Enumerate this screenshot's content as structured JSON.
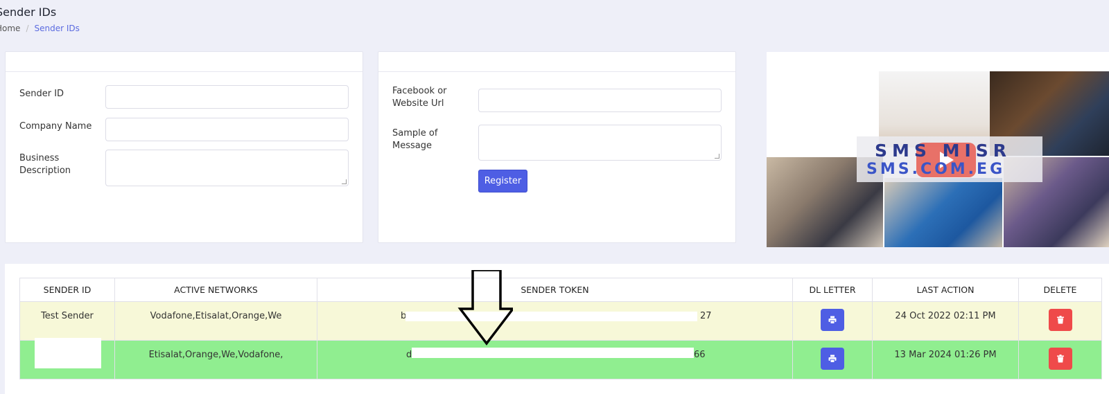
{
  "page": {
    "title": "Sender IDs",
    "breadcrumb": {
      "home": "Home",
      "current": "Sender IDs"
    }
  },
  "form_left": {
    "sender_id_label": "Sender ID",
    "company_name_label": "Company Name",
    "business_description_label": "Business Description",
    "sender_id_value": "",
    "company_name_value": "",
    "business_description_value": ""
  },
  "form_right": {
    "facebook_label": "Facebook or Website Url",
    "sample_label": "Sample of Message",
    "facebook_value": "",
    "sample_value": "",
    "register_label": "Register"
  },
  "promo": {
    "line1": "SMS MISR",
    "line2": "SMS.COM.EG"
  },
  "table": {
    "headers": [
      "SENDER ID",
      "ACTIVE NETWORKS",
      "SENDER TOKEN",
      "DL LETTER",
      "LAST ACTION",
      "DELETE"
    ],
    "rows": [
      {
        "sender_id": "Test Sender",
        "networks": "Vodafone,Etisalat,Orange,We",
        "token_start": "b",
        "token_end": "27",
        "last_action": "24 Oct 2022 02:11 PM",
        "status_color": "#f7f8d8"
      },
      {
        "sender_id": "",
        "networks": "Etisalat,Orange,We,Vodafone,",
        "token_start": "d",
        "token_end": "66",
        "last_action": "13 Mar 2024 01:26 PM",
        "status_color": "#90ee90"
      }
    ]
  },
  "icons": {
    "print": "print-icon",
    "delete": "trash-icon",
    "play": "play-icon",
    "arrow": "down-arrow-icon"
  },
  "colors": {
    "accent": "#4e5ee4",
    "danger": "#ef4a4a",
    "row_pending": "#f7f8d8",
    "row_active": "#90ee90"
  }
}
